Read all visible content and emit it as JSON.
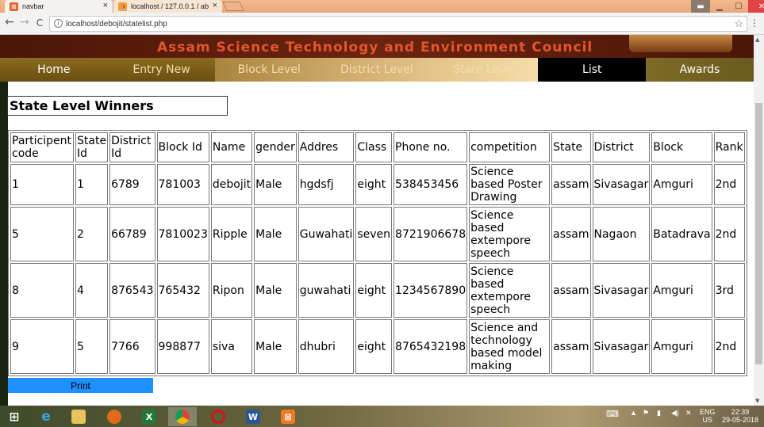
{
  "browser": {
    "tabs": [
      {
        "title": "navbar",
        "close": "×"
      },
      {
        "title": "localhost / 127.0.0.1 / ab",
        "close": "×"
      }
    ],
    "url": "localhost/debojit/statelist.php",
    "info_glyph": "i",
    "star_glyph": "☆",
    "menu_glyph": "⋮",
    "back_glyph": "←",
    "forward_glyph": "→",
    "reload_glyph": "C",
    "minimize_glyph": "▁",
    "close_glyph": "✕"
  },
  "site": {
    "banner_title": "Assam Science Technology and Environment Council",
    "nav": [
      {
        "label": "Home"
      },
      {
        "label": "Entry New"
      },
      {
        "label": "Block Level"
      },
      {
        "label": "District Level"
      },
      {
        "label": "State Level"
      },
      {
        "label": "List"
      },
      {
        "label": "Awards"
      }
    ],
    "active_nav": "List"
  },
  "main": {
    "heading": "State Level Winners",
    "table": {
      "headers": [
        "Participent code",
        "State Id",
        "District Id",
        "Block Id",
        "Name",
        "gender",
        "Addres",
        "Class",
        "Phone no.",
        "competition",
        "State",
        "District",
        "Block",
        "Rank"
      ],
      "rows": [
        [
          "1",
          "1",
          "6789",
          "781003",
          "debojit",
          "Male",
          "hgdsfj",
          "eight",
          "538453456",
          "Science based Poster Drawing",
          "assam",
          "Sivasagar",
          "Amguri",
          "2nd"
        ],
        [
          "5",
          "2",
          "66789",
          "7810023",
          "Ripple",
          "Male",
          "Guwahati",
          "seven",
          "8721906678",
          "Science based extempore speech",
          "assam",
          "Nagaon",
          "Batadrava",
          "2nd"
        ],
        [
          "8",
          "4",
          "876543",
          "765432",
          "Ripon",
          "Male",
          "guwahati",
          "eight",
          "1234567890",
          "Science based extempore speech",
          "assam",
          "Sivasagar",
          "Amguri",
          "3rd"
        ],
        [
          "9",
          "5",
          "7766",
          "998877",
          "siva",
          "Male",
          "dhubri",
          "eight",
          "8765432198",
          "Science and technology based model making",
          "assam",
          "Sivasagar",
          "Amguri",
          "2nd"
        ]
      ]
    },
    "print_label": "Print"
  },
  "taskbar": {
    "apps": [
      "start",
      "internet-explorer",
      "file-explorer",
      "firefox",
      "excel",
      "chrome",
      "opera",
      "word",
      "xampp"
    ],
    "lang": "ENG",
    "region": "US",
    "time": "22:39",
    "date": "29-05-2018"
  },
  "colors": {
    "banner_text": "#e2552d",
    "menu_active": "#000000",
    "print_button": "#1e90ff"
  }
}
